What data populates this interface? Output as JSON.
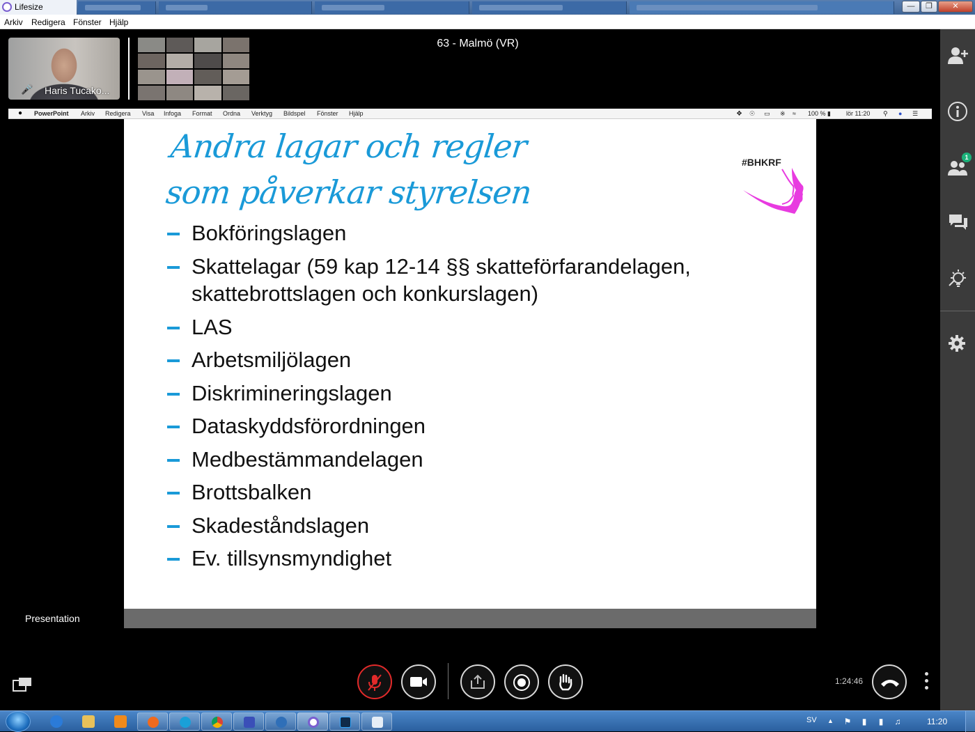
{
  "window": {
    "title": "Lifesize"
  },
  "menubar": {
    "items": [
      "Arkiv",
      "Redigera",
      "Fönster",
      "Hjälp"
    ]
  },
  "meeting": {
    "title": "63 - Malmö (VR)",
    "self_name": "Haris Tucako...",
    "presentation_label": "Presentation",
    "duration": "1:24:46",
    "participants_badge": "1"
  },
  "mac_menubar": {
    "items": [
      "PowerPoint",
      "Arkiv",
      "Redigera",
      "Visa",
      "Infoga",
      "Format",
      "Ordna",
      "Verktyg",
      "Bildspel",
      "Fönster",
      "Hjälp"
    ],
    "battery": "100 %",
    "clock": "lör 11:20"
  },
  "slide": {
    "title_line1": "Andra lagar och regler",
    "title_line2": "som påverkar styrelsen",
    "logo_text": "#BHKRF",
    "bullets": [
      "Bokföringslagen",
      "Skattelagar (59 kap 12-14 §§ skatteförfarandelagen, skattebrottslagen och konkurslagen)",
      "LAS",
      "Arbetsmiljölagen",
      "Diskrimineringslagen",
      "Dataskyddsförordningen",
      "Medbestämmandelagen",
      "Brottsbalken",
      "Skadeståndslagen",
      "Ev. tillsynsmyndighet"
    ]
  },
  "taskbar": {
    "language": "SV",
    "clock": "11:20"
  },
  "colors": {
    "slide_title": "#1a9ad8",
    "logo_pink": "#e83be0",
    "mute_red": "#e22a2a",
    "sidebar_bg": "#3b3b3b",
    "badge_green": "#1bb27a"
  }
}
